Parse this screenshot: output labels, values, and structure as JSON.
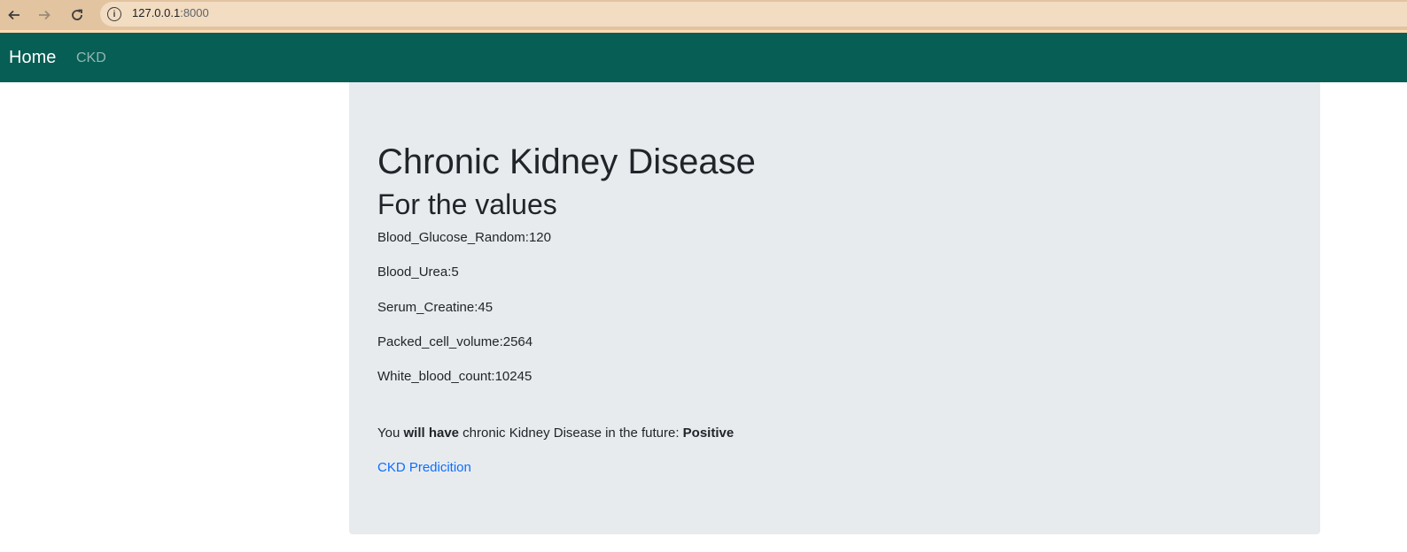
{
  "browser": {
    "url_host": "127.0.0.1",
    "url_port": ":8000"
  },
  "navbar": {
    "brand": "Home",
    "links": [
      "CKD"
    ]
  },
  "main": {
    "title": "Chronic Kidney Disease",
    "subtitle": "For the values",
    "values": [
      "Blood_Glucose_Random:120",
      "Blood_Urea:5",
      "Serum_Creatine:45",
      "Packed_cell_volume:2564",
      "White_blood_count:10245"
    ],
    "result": {
      "prefix": "You ",
      "emphasis": "will have",
      "middle": " chronic Kidney Disease in the future: ",
      "verdict": "Positive"
    },
    "link_label": "CKD Predicition"
  }
}
